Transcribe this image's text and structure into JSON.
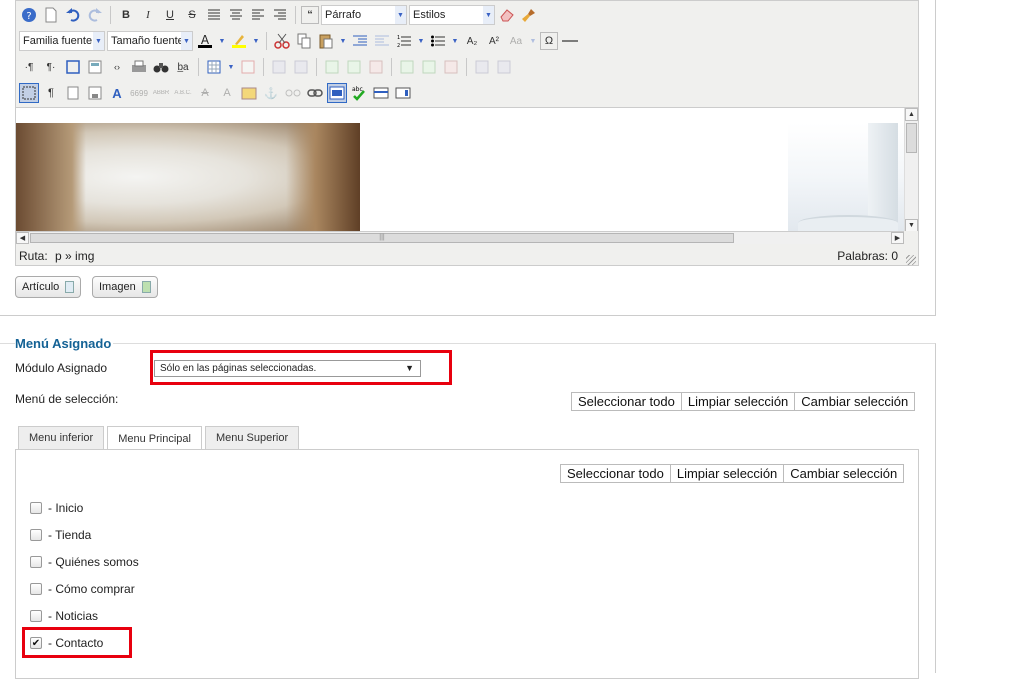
{
  "editor": {
    "toolbar": {
      "format_select": "Párrafo",
      "styles_select": "Estilos",
      "font_family_select": "Familia fuente",
      "font_size_select": "Tamaño fuente"
    },
    "statusbar": {
      "path_label": "Ruta:",
      "path_value": "p » img",
      "words": "Palabras: 0"
    },
    "buttons": {
      "article": "Artículo",
      "image": "Imagen"
    }
  },
  "menu": {
    "legend": "Menú Asignado",
    "module_label": "Módulo Asignado",
    "module_select": "Sólo en las páginas seleccionadas.",
    "selection_label": "Menú de selección:",
    "select_all": "Seleccionar todo",
    "clear_selection": "Limpiar selección",
    "toggle_selection": "Cambiar selección",
    "tabs": [
      "Menu inferior",
      "Menu Principal",
      "Menu Superior"
    ],
    "active_tab": "Menu Principal",
    "items": [
      {
        "label": "- Inicio",
        "checked": false
      },
      {
        "label": "- Tienda",
        "checked": false
      },
      {
        "label": "- Quiénes somos",
        "checked": false
      },
      {
        "label": "- Cómo comprar",
        "checked": false
      },
      {
        "label": "- Noticias",
        "checked": false
      },
      {
        "label": "- Contacto",
        "checked": true
      }
    ]
  },
  "colors": {
    "highlight": "#e8000e",
    "legend": "#146295"
  }
}
